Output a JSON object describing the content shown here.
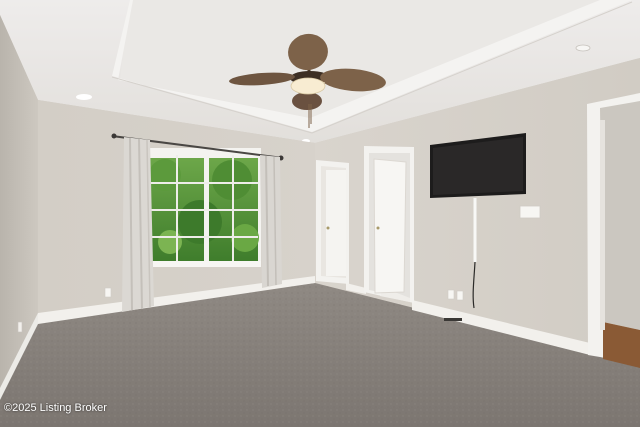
{
  "photo": {
    "subject": "empty bedroom with ceiling fan, window, wall-mounted TV and carpet",
    "watermark": "©2025 Listing Broker"
  }
}
